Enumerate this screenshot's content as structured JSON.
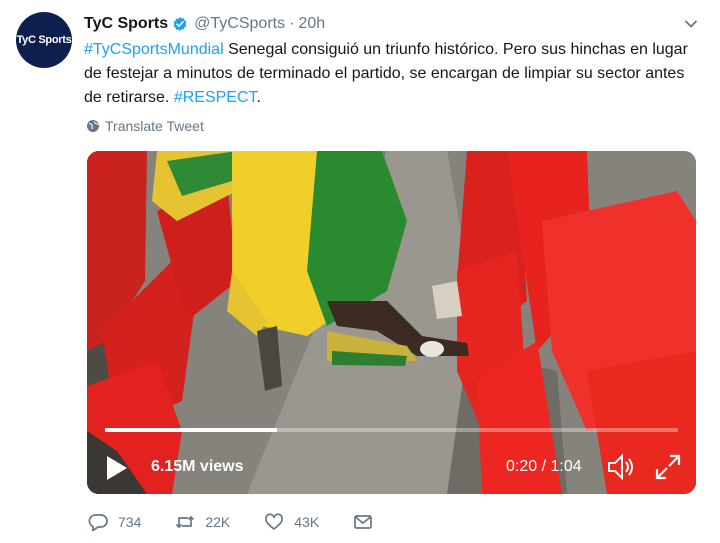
{
  "author": {
    "avatar_text": "TyC Sports",
    "name": "TyC Sports",
    "handle": "@TyCSports",
    "separator": "·",
    "time": "20h"
  },
  "tweet": {
    "hashtag1": "#TyCSportsMundial",
    "body": " Senegal consiguió un triunfo histórico. Pero sus hinchas en lugar de festejar a minutos de terminado el partido, se encargan de limpiar su sector antes de retirarse. ",
    "hashtag2": "#RESPECT",
    "end": "."
  },
  "translate_label": "Translate Tweet",
  "video": {
    "views": "6.15M views",
    "timecode": "0:20 / 1:04",
    "progress": 0.3
  },
  "actions": {
    "replies": "734",
    "retweets": "22K",
    "likes": "43K"
  },
  "colors": {
    "link": "#1da1f2",
    "secondary": "#657786",
    "seat_red": "#e01f24"
  },
  "icons": [
    "verified-icon",
    "chevron-down-icon",
    "globe-icon",
    "play-icon",
    "volume-icon",
    "fullscreen-icon",
    "reply-icon",
    "retweet-icon",
    "like-icon",
    "direct-message-icon"
  ]
}
